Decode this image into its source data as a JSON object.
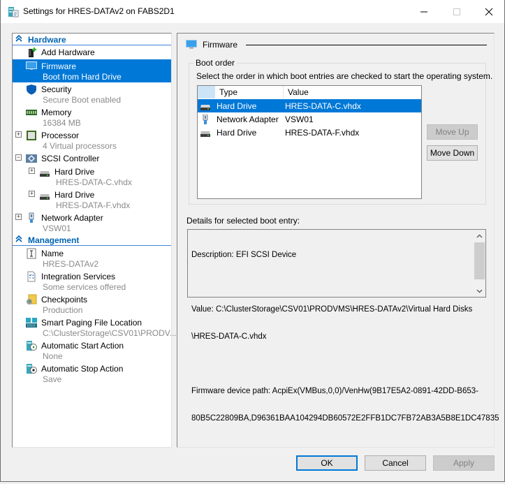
{
  "window": {
    "title": "Settings for HRES-DATAv2 on FABS2D1",
    "icon": "vm-settings-icon",
    "controls": {
      "minimize": "minimize-icon",
      "maximize": "maximize-icon",
      "close": "close-icon"
    }
  },
  "sidebar": {
    "sections": [
      {
        "label": "Hardware",
        "icon": "collapse-chevron-icon",
        "items": [
          {
            "name": "Add Hardware",
            "sub": "",
            "icon": "add-hardware-icon"
          },
          {
            "name": "Firmware",
            "sub": "Boot from Hard Drive",
            "icon": "firmware-icon",
            "selected": true
          },
          {
            "name": "Security",
            "sub": "Secure Boot enabled",
            "icon": "shield-icon"
          },
          {
            "name": "Memory",
            "sub": "16384 MB",
            "icon": "memory-icon"
          },
          {
            "name": "Processor",
            "sub": "4 Virtual processors",
            "icon": "processor-icon",
            "expander": "+"
          },
          {
            "name": "SCSI Controller",
            "sub": "",
            "icon": "scsi-controller-icon",
            "expander": "−"
          },
          {
            "name": "Hard Drive",
            "sub": "HRES-DATA-C.vhdx",
            "icon": "hard-drive-icon",
            "expander": "+"
          },
          {
            "name": "Hard Drive",
            "sub": "HRES-DATA-F.vhdx",
            "icon": "hard-drive-icon",
            "expander": "+"
          },
          {
            "name": "Network Adapter",
            "sub": "VSW01",
            "icon": "network-adapter-icon",
            "expander": "+"
          }
        ]
      },
      {
        "label": "Management",
        "icon": "collapse-chevron-icon",
        "items": [
          {
            "name": "Name",
            "sub": "HRES-DATAv2",
            "icon": "name-icon"
          },
          {
            "name": "Integration Services",
            "sub": "Some services offered",
            "icon": "integration-services-icon"
          },
          {
            "name": "Checkpoints",
            "sub": "Production",
            "icon": "checkpoints-icon"
          },
          {
            "name": "Smart Paging File Location",
            "sub": "C:\\ClusterStorage\\CSV01\\PRODV...",
            "icon": "smart-paging-icon"
          },
          {
            "name": "Automatic Start Action",
            "sub": "None",
            "icon": "auto-start-icon"
          },
          {
            "name": "Automatic Stop Action",
            "sub": "Save",
            "icon": "auto-stop-icon"
          }
        ]
      }
    ]
  },
  "firmware": {
    "title": "Firmware",
    "boot_order": {
      "group_label": "Boot order",
      "instruction": "Select the order in which boot entries are checked to start the operating system.",
      "columns": [
        "Type",
        "Value"
      ],
      "rows": [
        {
          "type": "Hard Drive",
          "value": "HRES-DATA-C.vhdx",
          "icon": "hard-drive-icon",
          "selected": true
        },
        {
          "type": "Network Adapter",
          "value": "VSW01",
          "icon": "network-adapter-icon"
        },
        {
          "type": "Hard Drive",
          "value": "HRES-DATA-F.vhdx",
          "icon": "hard-drive-icon"
        }
      ],
      "move_up": "Move Up",
      "move_down": "Move Down"
    },
    "details": {
      "label": "Details for selected boot entry:",
      "lines": [
        "Description: EFI SCSI Device",
        "",
        "Value: C:\\ClusterStorage\\CSV01\\PRODVMS\\HRES-DATAv2\\Virtual Hard Disks",
        "\\HRES-DATA-C.vhdx",
        "",
        "Firmware device path: AcpiEx(VMBus,0,0)/VenHw(9B17E5A2-0891-42DD-B653-",
        "80B5C22809BA,D96361BAA104294DB60572E2FFB1DC7FB72AB3A5B8E1DC47835"
      ]
    }
  },
  "footer": {
    "ok": "OK",
    "cancel": "Cancel",
    "apply": "Apply"
  },
  "colors": {
    "accent": "#0078d7",
    "section_header": "#0063b1",
    "sub_text": "#8a8a8a"
  }
}
